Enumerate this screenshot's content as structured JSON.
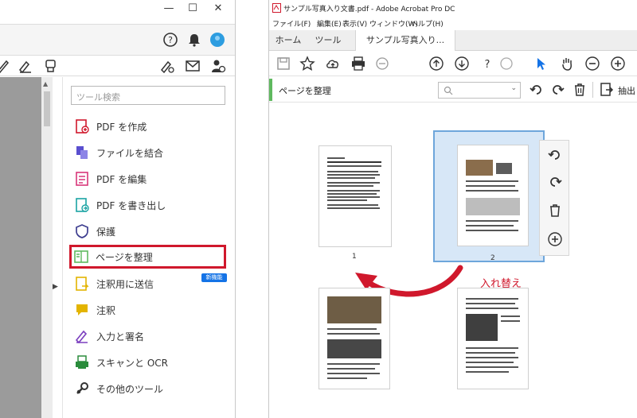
{
  "left_panel": {
    "window_controls": {
      "minimize": "—",
      "maximize": "☐",
      "close": "✕"
    },
    "search_placeholder": "ツール検索",
    "tools": [
      {
        "label": "PDF を作成",
        "icon": "create-pdf-icon",
        "color": "#d0182c"
      },
      {
        "label": "ファイルを結合",
        "icon": "combine-files-icon",
        "color": "#5a4fcf"
      },
      {
        "label": "PDF を編集",
        "icon": "edit-pdf-icon",
        "color": "#d9367a"
      },
      {
        "label": "PDF を書き出し",
        "icon": "export-pdf-icon",
        "color": "#1aa3a3"
      },
      {
        "label": "保護",
        "icon": "protect-icon",
        "color": "#3d3d8f"
      },
      {
        "label": "ページを整理",
        "icon": "organize-pages-icon",
        "color": "#5fb95f"
      },
      {
        "label": "注釈用に送信",
        "icon": "send-comments-icon",
        "color": "#e3b400"
      },
      {
        "label": "注釈",
        "icon": "comment-icon",
        "color": "#e3b400"
      },
      {
        "label": "入力と署名",
        "icon": "fill-sign-icon",
        "color": "#7b3fbf"
      },
      {
        "label": "スキャンと OCR",
        "icon": "scan-ocr-icon",
        "color": "#2a8c3c"
      },
      {
        "label": "その他のツール",
        "icon": "more-tools-icon",
        "color": "#333333"
      }
    ],
    "new_badge": "新機能",
    "highlight_color": "#d0182c"
  },
  "right_window": {
    "title": "サンプル写真入り文書.pdf - Adobe Acrobat Pro DC",
    "menu": [
      "ファイル(F)",
      "編集(E)",
      "表示(V)",
      "ウィンドウ(W)",
      "ヘルプ(H)"
    ],
    "tabs": [
      "ホーム",
      "ツール",
      "サンプル写真入り..."
    ],
    "organize_title": "ページを整理",
    "extract_label": "抽出",
    "pages": [
      {
        "number": "1"
      },
      {
        "number": "2"
      }
    ],
    "swap_annotation": "入れ替え",
    "accent_color": "#5fb95f",
    "selection_color": "#d7e7f7"
  }
}
